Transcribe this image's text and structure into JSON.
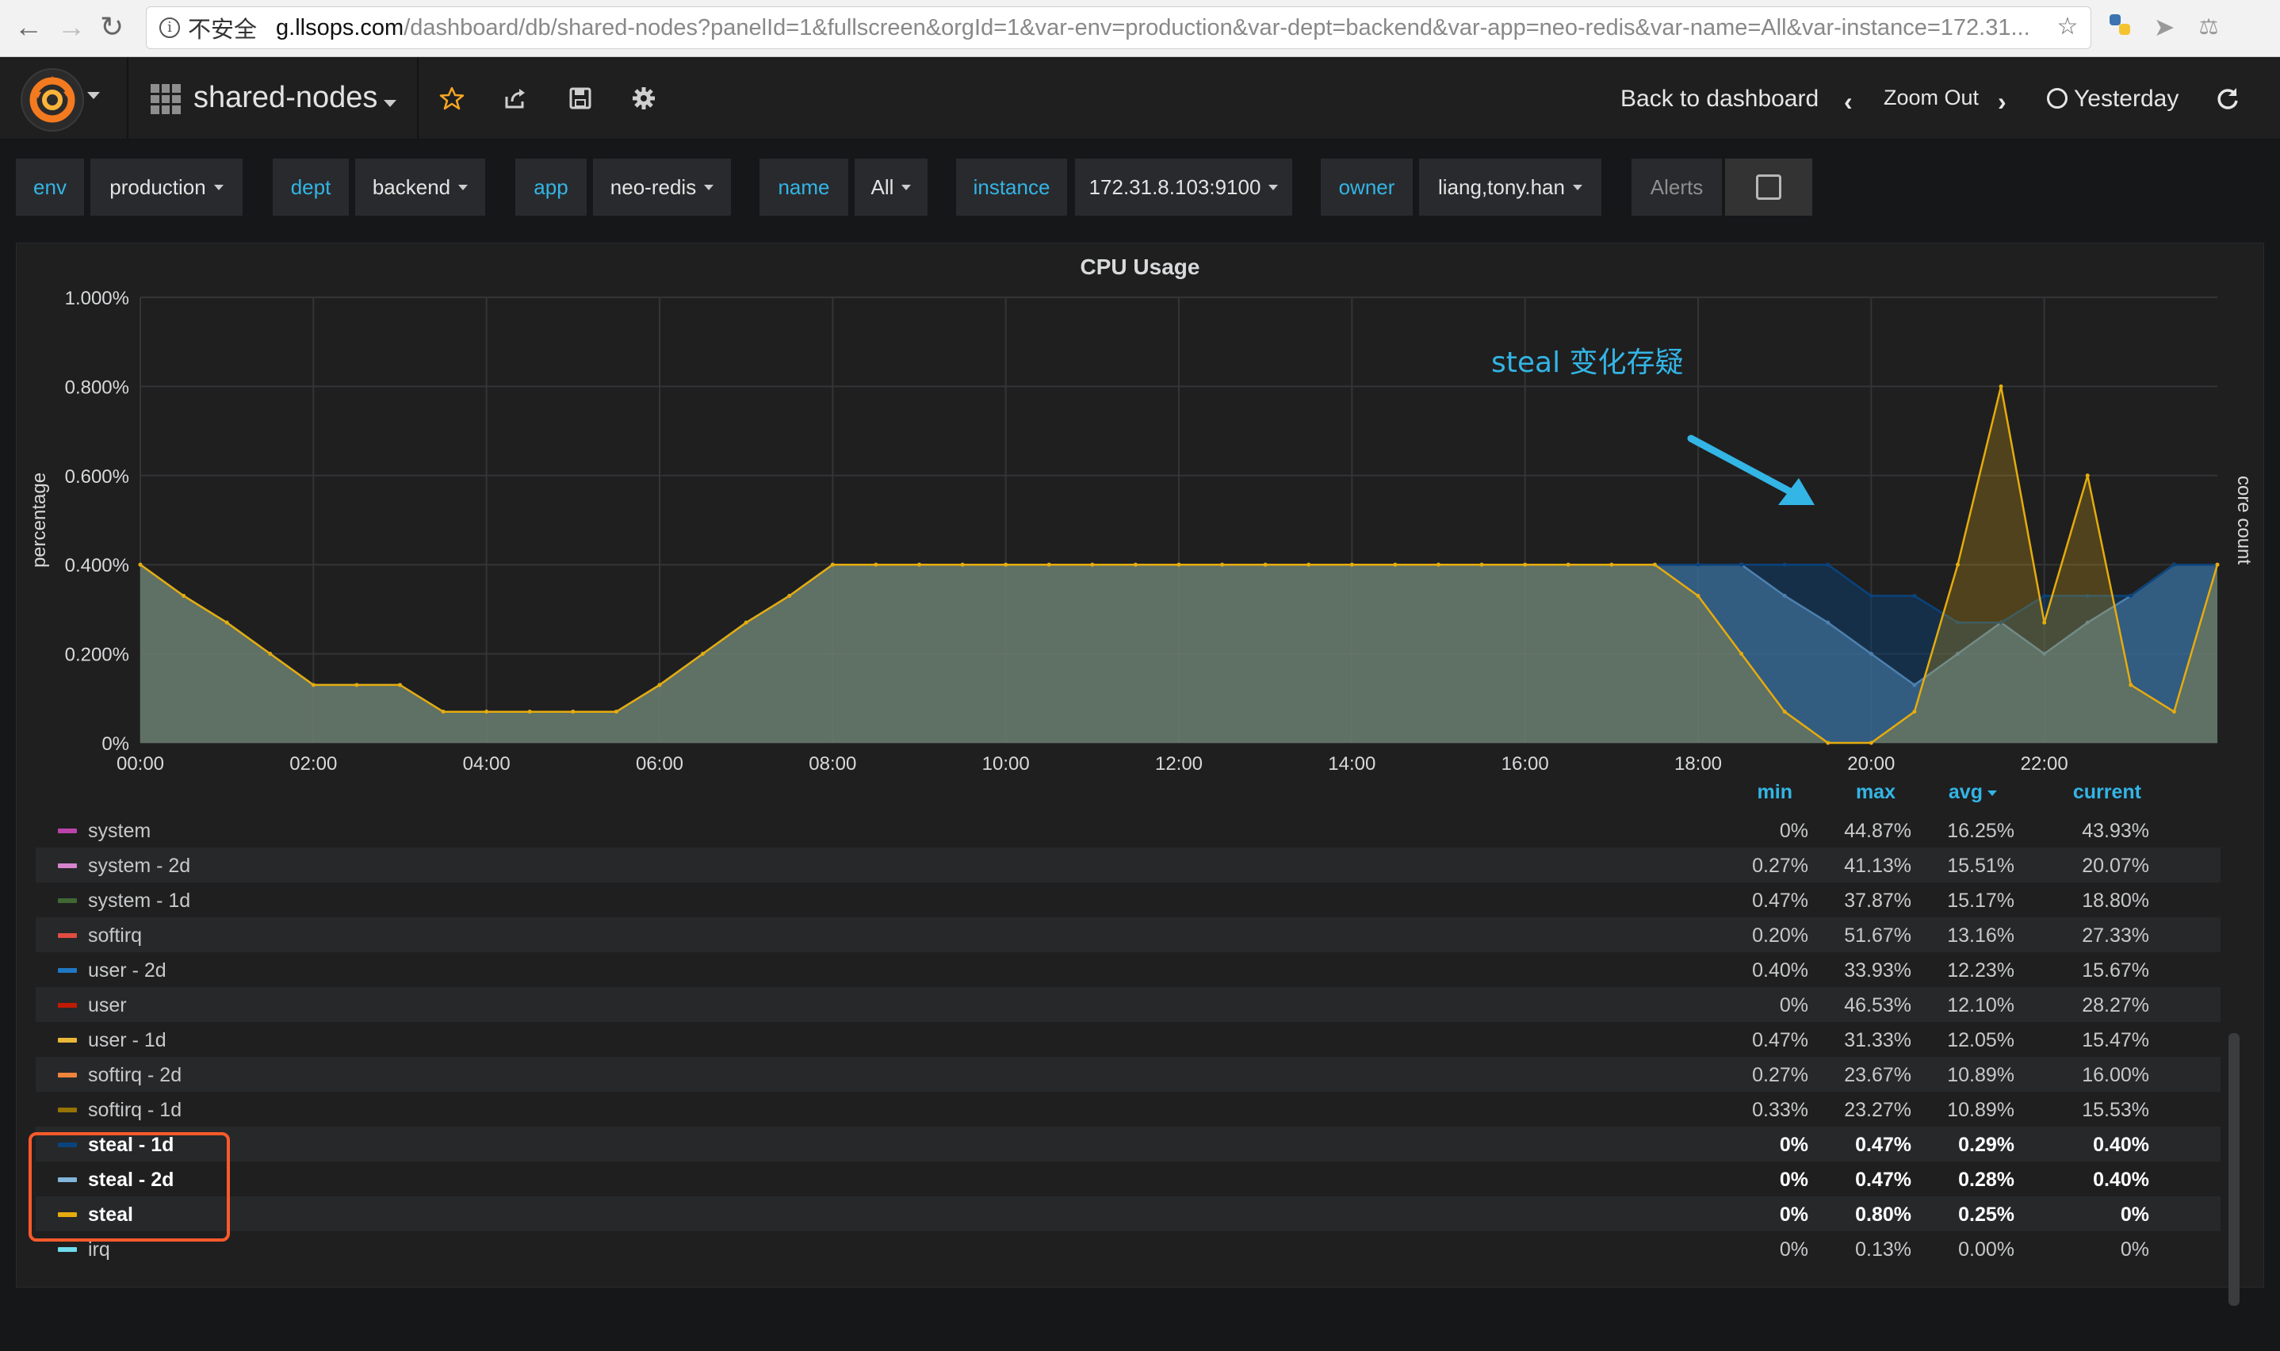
{
  "browser": {
    "back_icon": "back-arrow-icon",
    "forward_icon": "forward-arrow-icon",
    "reload_icon": "reload-icon",
    "security_label": "不安全",
    "url_host": "g.llsops.com",
    "url_path": "/dashboard/db/shared-nodes?panelId=1&fullscreen&orgId=1&var-env=production&var-dept=backend&var-app=neo-redis&var-name=All&var-instance=172.31...",
    "extensions": [
      "star-icon",
      "python-extension-icon",
      "bird-extension-icon",
      "flask-extension-icon"
    ]
  },
  "navbar": {
    "dashboard_title": "shared-nodes",
    "back_to_dashboard": "Back to dashboard",
    "zoom_out": "Zoom Out",
    "time_range": "Yesterday",
    "icons": [
      "star-icon",
      "share-icon",
      "save-icon",
      "settings-icon",
      "refresh-icon"
    ]
  },
  "variables": [
    {
      "label": "env",
      "value": "production"
    },
    {
      "label": "dept",
      "value": "backend"
    },
    {
      "label": "app",
      "value": "neo-redis"
    },
    {
      "label": "name",
      "value": "All"
    },
    {
      "label": "instance",
      "value": "172.31.8.103:9100"
    },
    {
      "label": "owner",
      "value": "liang,tony.han"
    }
  ],
  "alerts_label": "Alerts",
  "annotation": "steal 变化存疑",
  "legend": {
    "headers": {
      "min": "min",
      "max": "max",
      "avg": "avg",
      "current": "current"
    },
    "rows": [
      {
        "name": "system",
        "color": "#ba43a9",
        "min": "0%",
        "max": "44.87%",
        "avg": "16.25%",
        "current": "43.93%"
      },
      {
        "name": "system - 2d",
        "color": "#d683ce",
        "min": "0.27%",
        "max": "41.13%",
        "avg": "15.51%",
        "current": "20.07%"
      },
      {
        "name": "system - 1d",
        "color": "#3f6833",
        "min": "0.47%",
        "max": "37.87%",
        "avg": "15.17%",
        "current": "18.80%"
      },
      {
        "name": "softirq",
        "color": "#e24d42",
        "min": "0.20%",
        "max": "51.67%",
        "avg": "13.16%",
        "current": "27.33%"
      },
      {
        "name": "user - 2d",
        "color": "#1f78c1",
        "min": "0.40%",
        "max": "33.93%",
        "avg": "12.23%",
        "current": "15.67%"
      },
      {
        "name": "user",
        "color": "#bf1b00",
        "min": "0%",
        "max": "46.53%",
        "avg": "12.10%",
        "current": "28.27%"
      },
      {
        "name": "user - 1d",
        "color": "#eab839",
        "min": "0.47%",
        "max": "31.33%",
        "avg": "12.05%",
        "current": "15.47%"
      },
      {
        "name": "softirq - 2d",
        "color": "#ef843c",
        "min": "0.27%",
        "max": "23.67%",
        "avg": "10.89%",
        "current": "16.00%"
      },
      {
        "name": "softirq - 1d",
        "color": "#967302",
        "min": "0.33%",
        "max": "23.27%",
        "avg": "10.89%",
        "current": "15.53%"
      },
      {
        "name": "steal - 1d",
        "color": "#0a437c",
        "min": "0%",
        "max": "0.47%",
        "avg": "0.29%",
        "current": "0.40%"
      },
      {
        "name": "steal - 2d",
        "color": "#82b5d8",
        "min": "0%",
        "max": "0.47%",
        "avg": "0.28%",
        "current": "0.40%"
      },
      {
        "name": "steal",
        "color": "#e5ac0e",
        "min": "0%",
        "max": "0.80%",
        "avg": "0.25%",
        "current": "0%"
      },
      {
        "name": "irq",
        "color": "#70dbed",
        "min": "0%",
        "max": "0.13%",
        "avg": "0.00%",
        "current": "0%"
      }
    ]
  },
  "chart_data": {
    "type": "area",
    "title": "CPU Usage",
    "ylabel": "percentage",
    "y2label": "core count",
    "ylim": [
      0,
      1.0
    ],
    "yticks": [
      "0%",
      "0.200%",
      "0.400%",
      "0.600%",
      "0.800%",
      "1.000%"
    ],
    "xticks": [
      "00:00",
      "02:00",
      "04:00",
      "06:00",
      "08:00",
      "10:00",
      "12:00",
      "14:00",
      "16:00",
      "18:00",
      "20:00",
      "22:00"
    ],
    "grid": true,
    "x_hours": [
      0,
      0.5,
      1,
      1.5,
      2,
      2.5,
      3,
      3.5,
      4,
      4.5,
      5,
      5.5,
      6,
      6.5,
      7,
      7.5,
      8,
      8.5,
      9,
      9.5,
      10,
      10.5,
      11,
      11.5,
      12,
      12.5,
      13,
      13.5,
      14,
      14.5,
      15,
      15.5,
      16,
      16.5,
      17,
      17.5,
      18,
      18.5,
      19,
      19.5,
      20,
      20.5,
      21,
      21.5,
      22,
      22.5,
      23,
      23.5,
      24
    ],
    "series": [
      {
        "name": "steal - 2d",
        "color": "#82b5d8",
        "values": [
          0.4,
          0.33,
          0.27,
          0.2,
          0.13,
          0.13,
          0.13,
          0.07,
          0.07,
          0.07,
          0.07,
          0.07,
          0.13,
          0.2,
          0.27,
          0.33,
          0.4,
          0.4,
          0.4,
          0.4,
          0.4,
          0.4,
          0.4,
          0.4,
          0.4,
          0.4,
          0.4,
          0.4,
          0.4,
          0.4,
          0.4,
          0.4,
          0.4,
          0.4,
          0.4,
          0.4,
          0.4,
          0.4,
          0.33,
          0.27,
          0.2,
          0.13,
          0.2,
          0.27,
          0.2,
          0.27,
          0.33,
          0.4,
          0.4
        ]
      },
      {
        "name": "steal - 1d",
        "color": "#0a437c",
        "values": [
          0.4,
          0.33,
          0.27,
          0.2,
          0.13,
          0.13,
          0.13,
          0.07,
          0.07,
          0.07,
          0.07,
          0.07,
          0.13,
          0.2,
          0.27,
          0.33,
          0.4,
          0.4,
          0.4,
          0.4,
          0.4,
          0.4,
          0.4,
          0.4,
          0.4,
          0.4,
          0.4,
          0.4,
          0.4,
          0.4,
          0.4,
          0.4,
          0.4,
          0.4,
          0.4,
          0.4,
          0.4,
          0.4,
          0.4,
          0.4,
          0.33,
          0.33,
          0.27,
          0.27,
          0.33,
          0.33,
          0.33,
          0.4,
          0.4
        ]
      },
      {
        "name": "steal",
        "color": "#e5ac0e",
        "values": [
          0.4,
          0.33,
          0.27,
          0.2,
          0.13,
          0.13,
          0.13,
          0.07,
          0.07,
          0.07,
          0.07,
          0.07,
          0.13,
          0.2,
          0.27,
          0.33,
          0.4,
          0.4,
          0.4,
          0.4,
          0.4,
          0.4,
          0.4,
          0.4,
          0.4,
          0.4,
          0.4,
          0.4,
          0.4,
          0.4,
          0.4,
          0.4,
          0.4,
          0.4,
          0.4,
          0.4,
          0.33,
          0.2,
          0.07,
          0.0,
          0.0,
          0.07,
          0.4,
          0.8,
          0.27,
          0.6,
          0.13,
          0.07,
          0.4
        ]
      }
    ]
  }
}
